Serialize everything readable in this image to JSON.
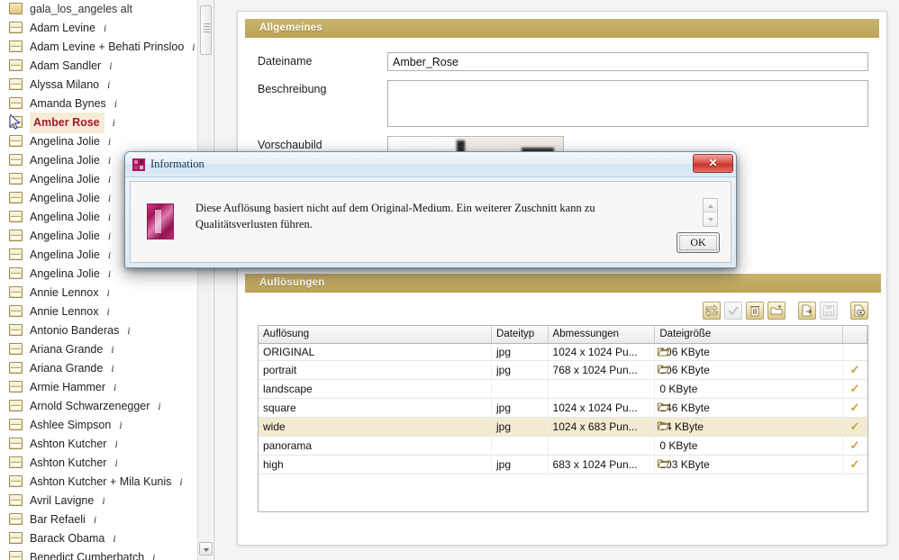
{
  "sidebar": {
    "scrollbar": {
      "down_arrow_icon": "chevron-down-icon"
    },
    "items": [
      {
        "label": "gala_los_angeles alt",
        "icon": "media-folder-icon",
        "info": "",
        "selected": false,
        "first": true
      },
      {
        "label": "Adam Levine",
        "icon": "media-folder-icon",
        "info": "i",
        "selected": false
      },
      {
        "label": "Adam Levine + Behati Prinsloo",
        "icon": "media-folder-icon",
        "info": "i",
        "selected": false
      },
      {
        "label": "Adam Sandler",
        "icon": "media-folder-icon",
        "info": "i",
        "selected": false
      },
      {
        "label": "Alyssa Milano",
        "icon": "media-folder-icon",
        "info": "i",
        "selected": false
      },
      {
        "label": "Amanda Bynes",
        "icon": "media-folder-icon",
        "info": "i",
        "selected": false
      },
      {
        "label": "Amber Rose",
        "icon": "media-folder-icon",
        "info": "i",
        "selected": true
      },
      {
        "label": "Angelina Jolie",
        "icon": "media-folder-icon",
        "info": "i",
        "selected": false
      },
      {
        "label": "Angelina Jolie",
        "icon": "media-folder-icon",
        "info": "i",
        "selected": false
      },
      {
        "label": "Angelina Jolie",
        "icon": "media-folder-icon",
        "info": "i",
        "selected": false
      },
      {
        "label": "Angelina Jolie",
        "icon": "media-folder-icon",
        "info": "i",
        "selected": false
      },
      {
        "label": "Angelina Jolie",
        "icon": "media-folder-icon",
        "info": "i",
        "selected": false
      },
      {
        "label": "Angelina Jolie",
        "icon": "media-folder-icon",
        "info": "i",
        "selected": false
      },
      {
        "label": "Angelina Jolie",
        "icon": "media-folder-icon",
        "info": "i",
        "selected": false
      },
      {
        "label": "Angelina Jolie",
        "icon": "media-folder-icon",
        "info": "i",
        "selected": false
      },
      {
        "label": "Annie Lennox",
        "icon": "media-folder-icon",
        "info": "i",
        "selected": false
      },
      {
        "label": "Annie Lennox",
        "icon": "media-folder-icon",
        "info": "i",
        "selected": false
      },
      {
        "label": "Antonio Banderas",
        "icon": "media-folder-icon",
        "info": "i",
        "selected": false
      },
      {
        "label": "Ariana Grande",
        "icon": "media-folder-icon",
        "info": "i",
        "selected": false
      },
      {
        "label": "Ariana Grande",
        "icon": "media-folder-icon",
        "info": "i",
        "selected": false
      },
      {
        "label": "Armie Hammer",
        "icon": "media-folder-icon",
        "info": "i",
        "selected": false
      },
      {
        "label": "Arnold Schwarzenegger",
        "icon": "media-folder-icon",
        "info": "i",
        "selected": false
      },
      {
        "label": "Ashlee Simpson",
        "icon": "media-folder-icon",
        "info": "i",
        "selected": false
      },
      {
        "label": "Ashton Kutcher",
        "icon": "media-folder-icon",
        "info": "i",
        "selected": false
      },
      {
        "label": "Ashton Kutcher",
        "icon": "media-folder-icon",
        "info": "i",
        "selected": false
      },
      {
        "label": "Ashton Kutcher + Mila Kunis",
        "icon": "media-folder-icon",
        "info": "i",
        "selected": false
      },
      {
        "label": "Avril Lavigne",
        "icon": "media-folder-icon",
        "info": "i",
        "selected": false
      },
      {
        "label": "Bar Refaeli",
        "icon": "media-folder-icon",
        "info": "i",
        "selected": false
      },
      {
        "label": "Barack Obama",
        "icon": "media-folder-icon",
        "info": "i",
        "selected": false
      },
      {
        "label": "Benedict Cumberbatch",
        "icon": "media-folder-icon",
        "info": "i",
        "selected": false
      }
    ]
  },
  "general": {
    "section_title": "Allgemeines",
    "filename_label": "Dateiname",
    "filename_value": "Amber_Rose",
    "description_label": "Beschreibung",
    "description_value": "",
    "description_placeholder": "",
    "preview_label": "Vorschaubild"
  },
  "resolutions": {
    "section_title": "Auflösungen",
    "toolbar": [
      {
        "name": "reprocess-button",
        "icon": "refresh-arrows-icon",
        "enabled": true
      },
      {
        "name": "approve-button",
        "icon": "check-icon",
        "enabled": false
      },
      {
        "name": "delete-button",
        "icon": "trash-icon",
        "enabled": true
      },
      {
        "name": "upload-button",
        "icon": "folder-upload-icon",
        "enabled": true
      },
      {
        "name": "export-button",
        "icon": "document-arrow-icon",
        "enabled": true
      },
      {
        "name": "save-button",
        "icon": "floppy-disk-icon",
        "enabled": false
      },
      {
        "name": "preview-button",
        "icon": "document-eye-icon",
        "enabled": true
      }
    ],
    "columns": [
      "Auflösung",
      "Dateityp",
      "Abmessungen",
      "",
      "Dateigröße",
      ""
    ],
    "rows": [
      {
        "resolution": "ORIGINAL",
        "filetype": "jpg",
        "dimensions": "1024 x 1024 Pu...",
        "has_folder": true,
        "filesize": "106 KByte",
        "checked": false,
        "selected": false
      },
      {
        "resolution": "portrait",
        "filetype": "jpg",
        "dimensions": "768 x 1024 Pun...",
        "has_folder": true,
        "filesize": "106 KByte",
        "checked": true,
        "selected": false
      },
      {
        "resolution": "landscape",
        "filetype": "",
        "dimensions": "",
        "has_folder": false,
        "filesize": "0 KByte",
        "checked": true,
        "selected": false
      },
      {
        "resolution": "square",
        "filetype": "jpg",
        "dimensions": "1024 x 1024 Pu...",
        "has_folder": true,
        "filesize": "146 KByte",
        "checked": true,
        "selected": false
      },
      {
        "resolution": "wide",
        "filetype": "jpg",
        "dimensions": "1024 x 683 Pun...",
        "has_folder": true,
        "filesize": "54 KByte",
        "checked": true,
        "selected": true
      },
      {
        "resolution": "panorama",
        "filetype": "",
        "dimensions": "",
        "has_folder": false,
        "filesize": "0 KByte",
        "checked": true,
        "selected": false
      },
      {
        "resolution": "high",
        "filetype": "jpg",
        "dimensions": "683 x 1024 Pun...",
        "has_folder": true,
        "filesize": "103 KByte",
        "checked": true,
        "selected": false
      }
    ]
  },
  "dialog": {
    "title": "Information",
    "title_icon": "app-logo-icon",
    "close_icon": "close-icon",
    "message_icon": "app-logo-icon",
    "message": "Diese Auflösung basiert nicht auf dem Original-Medium. Ein weiterer Zuschnitt kann zu Qualitätsverlusten führen.",
    "ok_label": "OK",
    "spinner_up_icon": "chevron-up-icon",
    "spinner_down_icon": "chevron-down-icon"
  },
  "colors": {
    "accent_gold": "#bda356",
    "selected_text": "#a61b2b",
    "selected_row": "#f2ead1",
    "check_gold": "#c8a13a",
    "dialog_border": "#6d8fae"
  }
}
